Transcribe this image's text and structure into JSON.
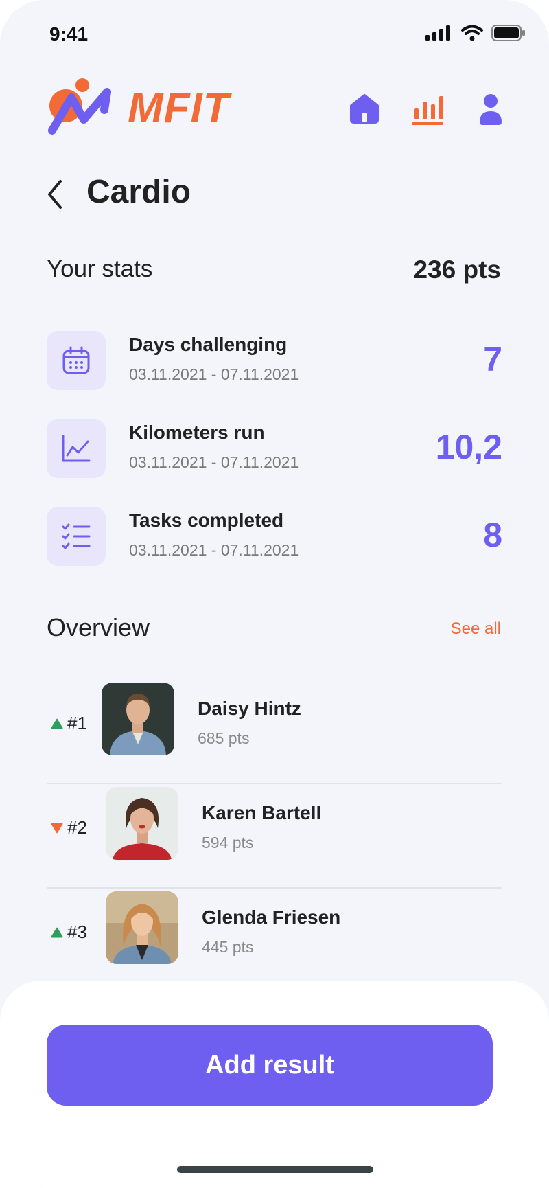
{
  "status_bar": {
    "time": "9:41"
  },
  "header": {
    "brand": "MFIT",
    "nav": [
      {
        "icon": "home-icon"
      },
      {
        "icon": "stats-icon",
        "active": true
      },
      {
        "icon": "user-icon"
      }
    ]
  },
  "page": {
    "title": "Cardio"
  },
  "stats": {
    "label": "Your stats",
    "points": "236 pts",
    "items": [
      {
        "icon": "calendar-icon",
        "title": "Days challenging",
        "date": "03.11.2021 - 07.11.2021",
        "value": "7"
      },
      {
        "icon": "chart-line-icon",
        "title": "Kilometers run",
        "date": "03.11.2021 - 07.11.2021",
        "value": "10,2"
      },
      {
        "icon": "checklist-icon",
        "title": "Tasks completed",
        "date": "03.11.2021 - 07.11.2021",
        "value": "8"
      }
    ]
  },
  "overview": {
    "label": "Overview",
    "see_all": "See all",
    "rows": [
      {
        "rank": "#1",
        "trend": "up",
        "name": "Daisy Hintz",
        "points": "685 pts"
      },
      {
        "rank": "#2",
        "trend": "down",
        "name": "Karen Bartell",
        "points": "594 pts"
      },
      {
        "rank": "#3",
        "trend": "up",
        "name": "Glenda Friesen",
        "points": "445 pts"
      }
    ]
  },
  "actions": {
    "add_result": "Add result"
  },
  "colors": {
    "accent": "#6e5ff0",
    "brand": "#f26a36",
    "up": "#2e9e5b",
    "down": "#f26a36"
  }
}
